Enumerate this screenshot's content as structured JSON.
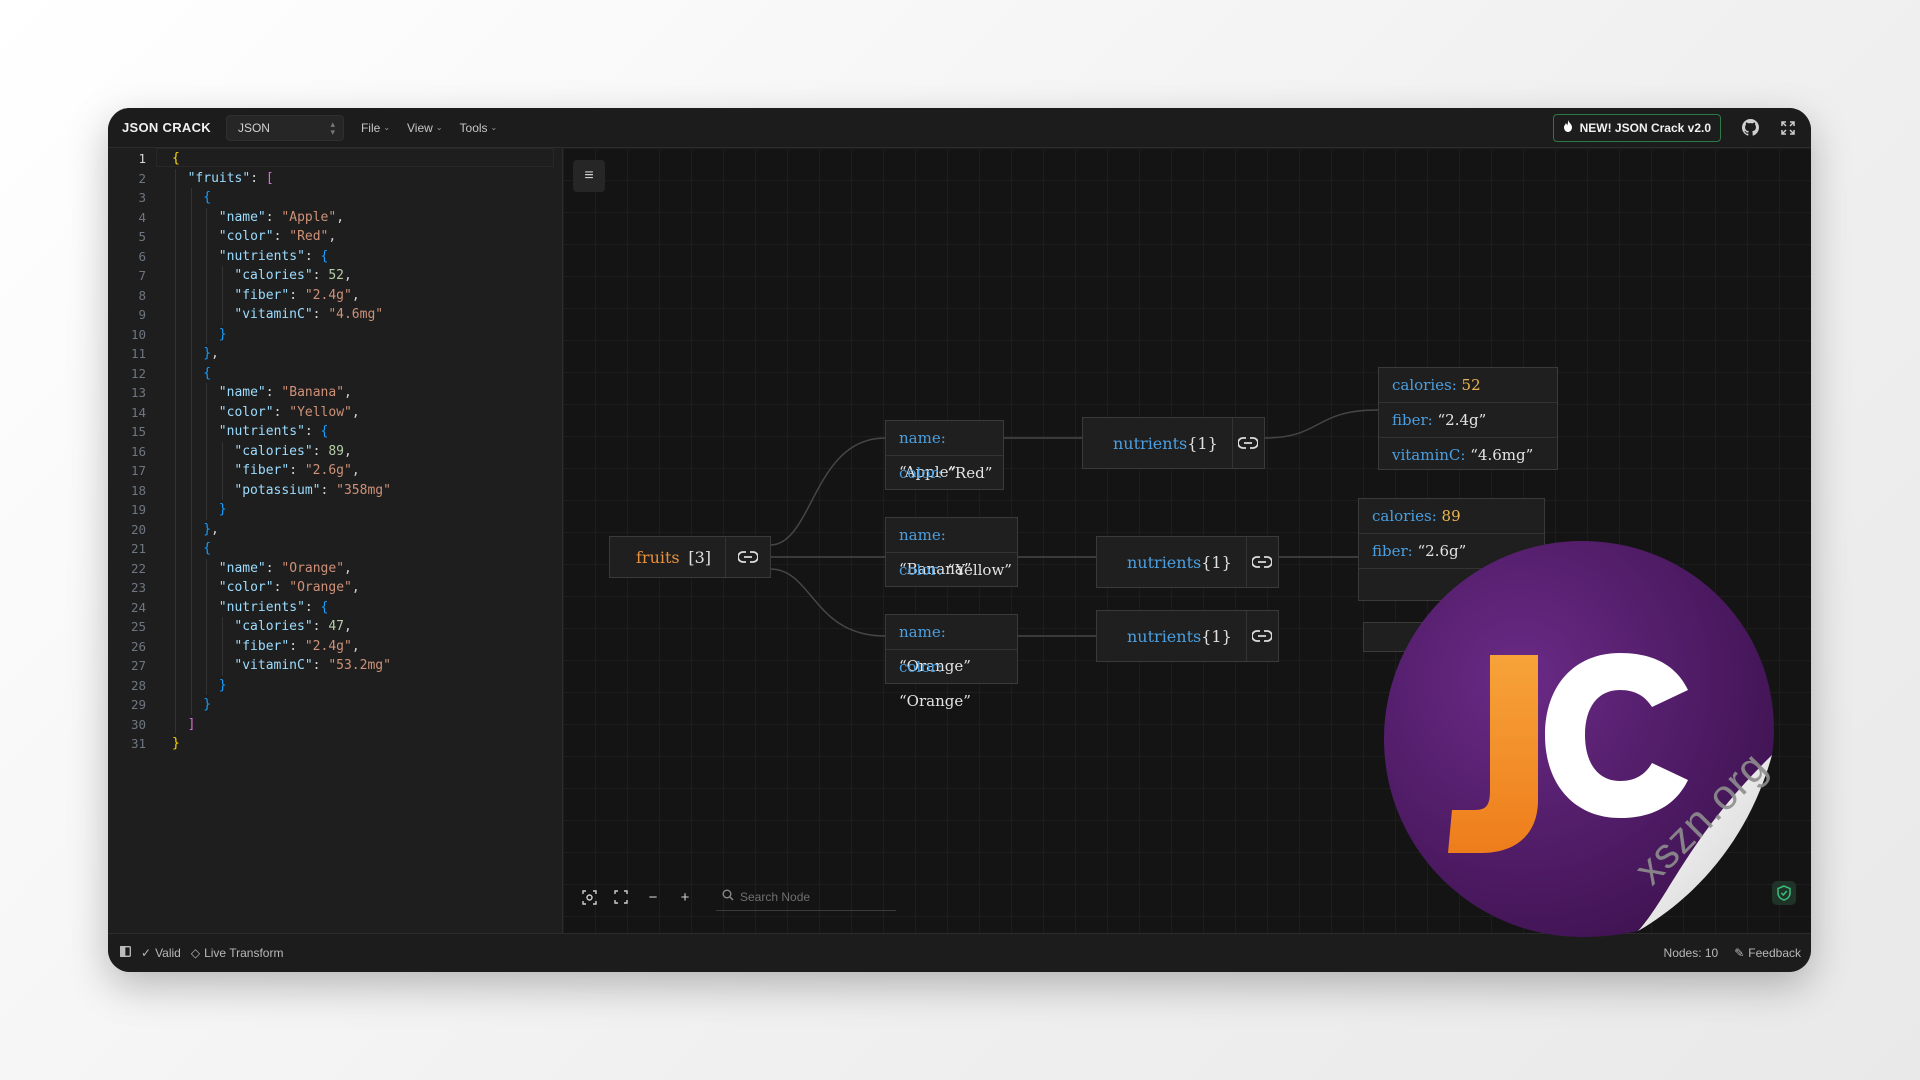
{
  "header": {
    "brand": "JSON CRACK",
    "format": "JSON",
    "menus": [
      "File",
      "View",
      "Tools"
    ],
    "new_button": "NEW! JSON Crack v2.0",
    "icons": [
      "fire-icon",
      "github-icon",
      "fullscreen-icon"
    ]
  },
  "editor": {
    "lines": [
      {
        "n": "1",
        "indent": 0,
        "code": "{"
      },
      {
        "n": "2",
        "indent": 1,
        "code": "\"fruits\": ["
      },
      {
        "n": "3",
        "indent": 2,
        "code": "{"
      },
      {
        "n": "4",
        "indent": 3,
        "code": "\"name\": \"Apple\","
      },
      {
        "n": "5",
        "indent": 3,
        "code": "\"color\": \"Red\","
      },
      {
        "n": "6",
        "indent": 3,
        "code": "\"nutrients\": {"
      },
      {
        "n": "7",
        "indent": 4,
        "code": "\"calories\": 52,"
      },
      {
        "n": "8",
        "indent": 4,
        "code": "\"fiber\": \"2.4g\","
      },
      {
        "n": "9",
        "indent": 4,
        "code": "\"vitaminC\": \"4.6mg\""
      },
      {
        "n": "10",
        "indent": 3,
        "code": "}"
      },
      {
        "n": "11",
        "indent": 2,
        "code": "},"
      },
      {
        "n": "12",
        "indent": 2,
        "code": "{"
      },
      {
        "n": "13",
        "indent": 3,
        "code": "\"name\": \"Banana\","
      },
      {
        "n": "14",
        "indent": 3,
        "code": "\"color\": \"Yellow\","
      },
      {
        "n": "15",
        "indent": 3,
        "code": "\"nutrients\": {"
      },
      {
        "n": "16",
        "indent": 4,
        "code": "\"calories\": 89,"
      },
      {
        "n": "17",
        "indent": 4,
        "code": "\"fiber\": \"2.6g\","
      },
      {
        "n": "18",
        "indent": 4,
        "code": "\"potassium\": \"358mg\""
      },
      {
        "n": "19",
        "indent": 3,
        "code": "}"
      },
      {
        "n": "20",
        "indent": 2,
        "code": "},"
      },
      {
        "n": "21",
        "indent": 2,
        "code": "{"
      },
      {
        "n": "22",
        "indent": 3,
        "code": "\"name\": \"Orange\","
      },
      {
        "n": "23",
        "indent": 3,
        "code": "\"color\": \"Orange\","
      },
      {
        "n": "24",
        "indent": 3,
        "code": "\"nutrients\": {"
      },
      {
        "n": "25",
        "indent": 4,
        "code": "\"calories\": 47,"
      },
      {
        "n": "26",
        "indent": 4,
        "code": "\"fiber\": \"2.4g\","
      },
      {
        "n": "27",
        "indent": 4,
        "code": "\"vitaminC\": \"53.2mg\""
      },
      {
        "n": "28",
        "indent": 3,
        "code": "}"
      },
      {
        "n": "29",
        "indent": 2,
        "code": "}"
      },
      {
        "n": "30",
        "indent": 1,
        "code": "]"
      },
      {
        "n": "31",
        "indent": 0,
        "code": "}"
      }
    ]
  },
  "graph": {
    "root": {
      "key": "fruits",
      "count": "[3]"
    },
    "items": [
      {
        "name_key": "name: ",
        "name_val": "“Apple”",
        "color_key": "color: ",
        "color_val": "“Red”"
      },
      {
        "name_key": "name: ",
        "name_val": "“Banana”",
        "color_key": "color: ",
        "color_val": "“Yellow”"
      },
      {
        "name_key": "name: ",
        "name_val": "“Orange”",
        "color_key": "color: ",
        "color_val": "“Orange”"
      }
    ],
    "nutrient_parents": [
      {
        "key": "nutrients",
        "count": "{1}"
      },
      {
        "key": "nutrients",
        "count": "{1}"
      },
      {
        "key": "nutrients",
        "count": "{1}"
      }
    ],
    "apple_nutrients": [
      {
        "k": "calories: ",
        "v": "52",
        "num": true
      },
      {
        "k": "fiber: ",
        "v": "“2.4g”",
        "num": false
      },
      {
        "k": "vitaminC: ",
        "v": "“4.6mg”",
        "num": false
      }
    ],
    "banana_nutrients": [
      {
        "k": "calories: ",
        "v": "89",
        "num": true
      },
      {
        "k": "fiber: ",
        "v": "“2.6g”",
        "num": false
      }
    ],
    "search_placeholder": "Search Node"
  },
  "status": {
    "valid": "Valid",
    "live_transform": "Live Transform",
    "nodes": "Nodes: 10",
    "feedback": "Feedback"
  },
  "logo": {
    "letters": "JC",
    "watermark": "xszn.org"
  },
  "colors": {
    "accent_green": "#2e7a46",
    "key_blue": "#4b9fe0",
    "number_orange": "#ecb553",
    "logo_purple": "#5a1f6e",
    "logo_orange": "#f4922a"
  }
}
